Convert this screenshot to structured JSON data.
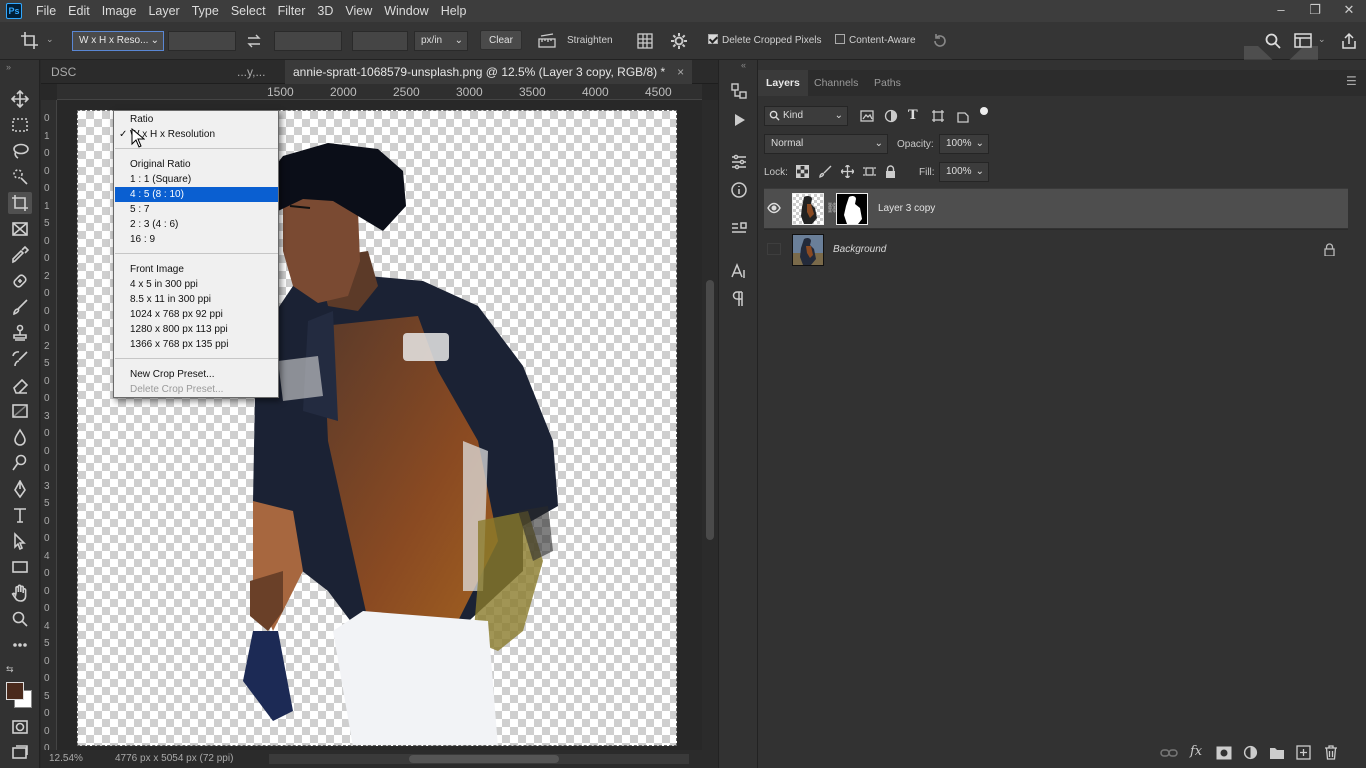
{
  "app": {
    "logo": "Ps"
  },
  "menu": [
    "File",
    "Edit",
    "Image",
    "Layer",
    "Type",
    "Select",
    "Filter",
    "3D",
    "View",
    "Window",
    "Help"
  ],
  "window_controls": [
    "–",
    "❐",
    "✕"
  ],
  "options": {
    "preset_value": "W x H x Reso...",
    "units": "px/in",
    "clear": "Clear",
    "straighten": "Straighten",
    "delete_cropped": "Delete Cropped Pixels",
    "content_aware": "Content-Aware"
  },
  "tabs": [
    {
      "label": "DSC"
    },
    {
      "label": "...y,..."
    },
    {
      "label": "annie-spratt-1068579-unsplash.png @ 12.5% (Layer 3 copy, RGB/8) *"
    }
  ],
  "tab_close": "×",
  "ruler": [
    "1500",
    "2000",
    "2500",
    "3000",
    "3500",
    "4000",
    "4500"
  ],
  "ruler_left": [
    "0",
    "1",
    "0",
    "0",
    "0",
    "1",
    "5",
    "0",
    "0",
    "2",
    "0",
    "0",
    "0",
    "2",
    "5",
    "0",
    "0",
    "3",
    "0",
    "0",
    "0",
    "3",
    "5",
    "0",
    "0",
    "4",
    "0",
    "0",
    "0",
    "4",
    "5",
    "0",
    "0",
    "5",
    "0",
    "0",
    "0"
  ],
  "status": {
    "zoom": "12.54%",
    "doc": "4776 px x 5054 px (72 ppi)"
  },
  "dropdown": {
    "items": [
      {
        "label": "Ratio",
        "checked": false
      },
      {
        "label": "W x H x Resolution",
        "checked": true
      },
      {
        "label": "Original Ratio"
      },
      {
        "label": "1 : 1 (Square)"
      },
      {
        "label": "4 : 5 (8 : 10)",
        "highlighted": true
      },
      {
        "label": "5 : 7"
      },
      {
        "label": "2 : 3 (4 : 6)"
      },
      {
        "label": "16 : 9"
      },
      {
        "label": "Front Image"
      },
      {
        "label": "4 x 5 in 300 ppi"
      },
      {
        "label": "8.5 x 11 in 300 ppi"
      },
      {
        "label": "1024 x 768 px 92 ppi"
      },
      {
        "label": "1280 x 800 px 113 ppi"
      },
      {
        "label": "1366 x 768 px 135 ppi"
      },
      {
        "label": "New Crop Preset..."
      },
      {
        "label": "Delete Crop Preset...",
        "disabled": true
      }
    ]
  },
  "layers_panel": {
    "tabs": [
      "Layers",
      "Channels",
      "Paths"
    ],
    "kind": "Kind",
    "blend": "Normal",
    "opacity_label": "Opacity:",
    "opacity": "100%",
    "lock_label": "Lock:",
    "fill_label": "Fill:",
    "fill": "100%",
    "layers": [
      {
        "name": "Layer 3 copy",
        "visible": true,
        "selected": true
      },
      {
        "name": "Background",
        "visible": false,
        "locked": true
      }
    ]
  },
  "colors": {
    "accent": "#0a5fd1",
    "foreground": "#4a2a1c",
    "background": "#ffffff"
  }
}
